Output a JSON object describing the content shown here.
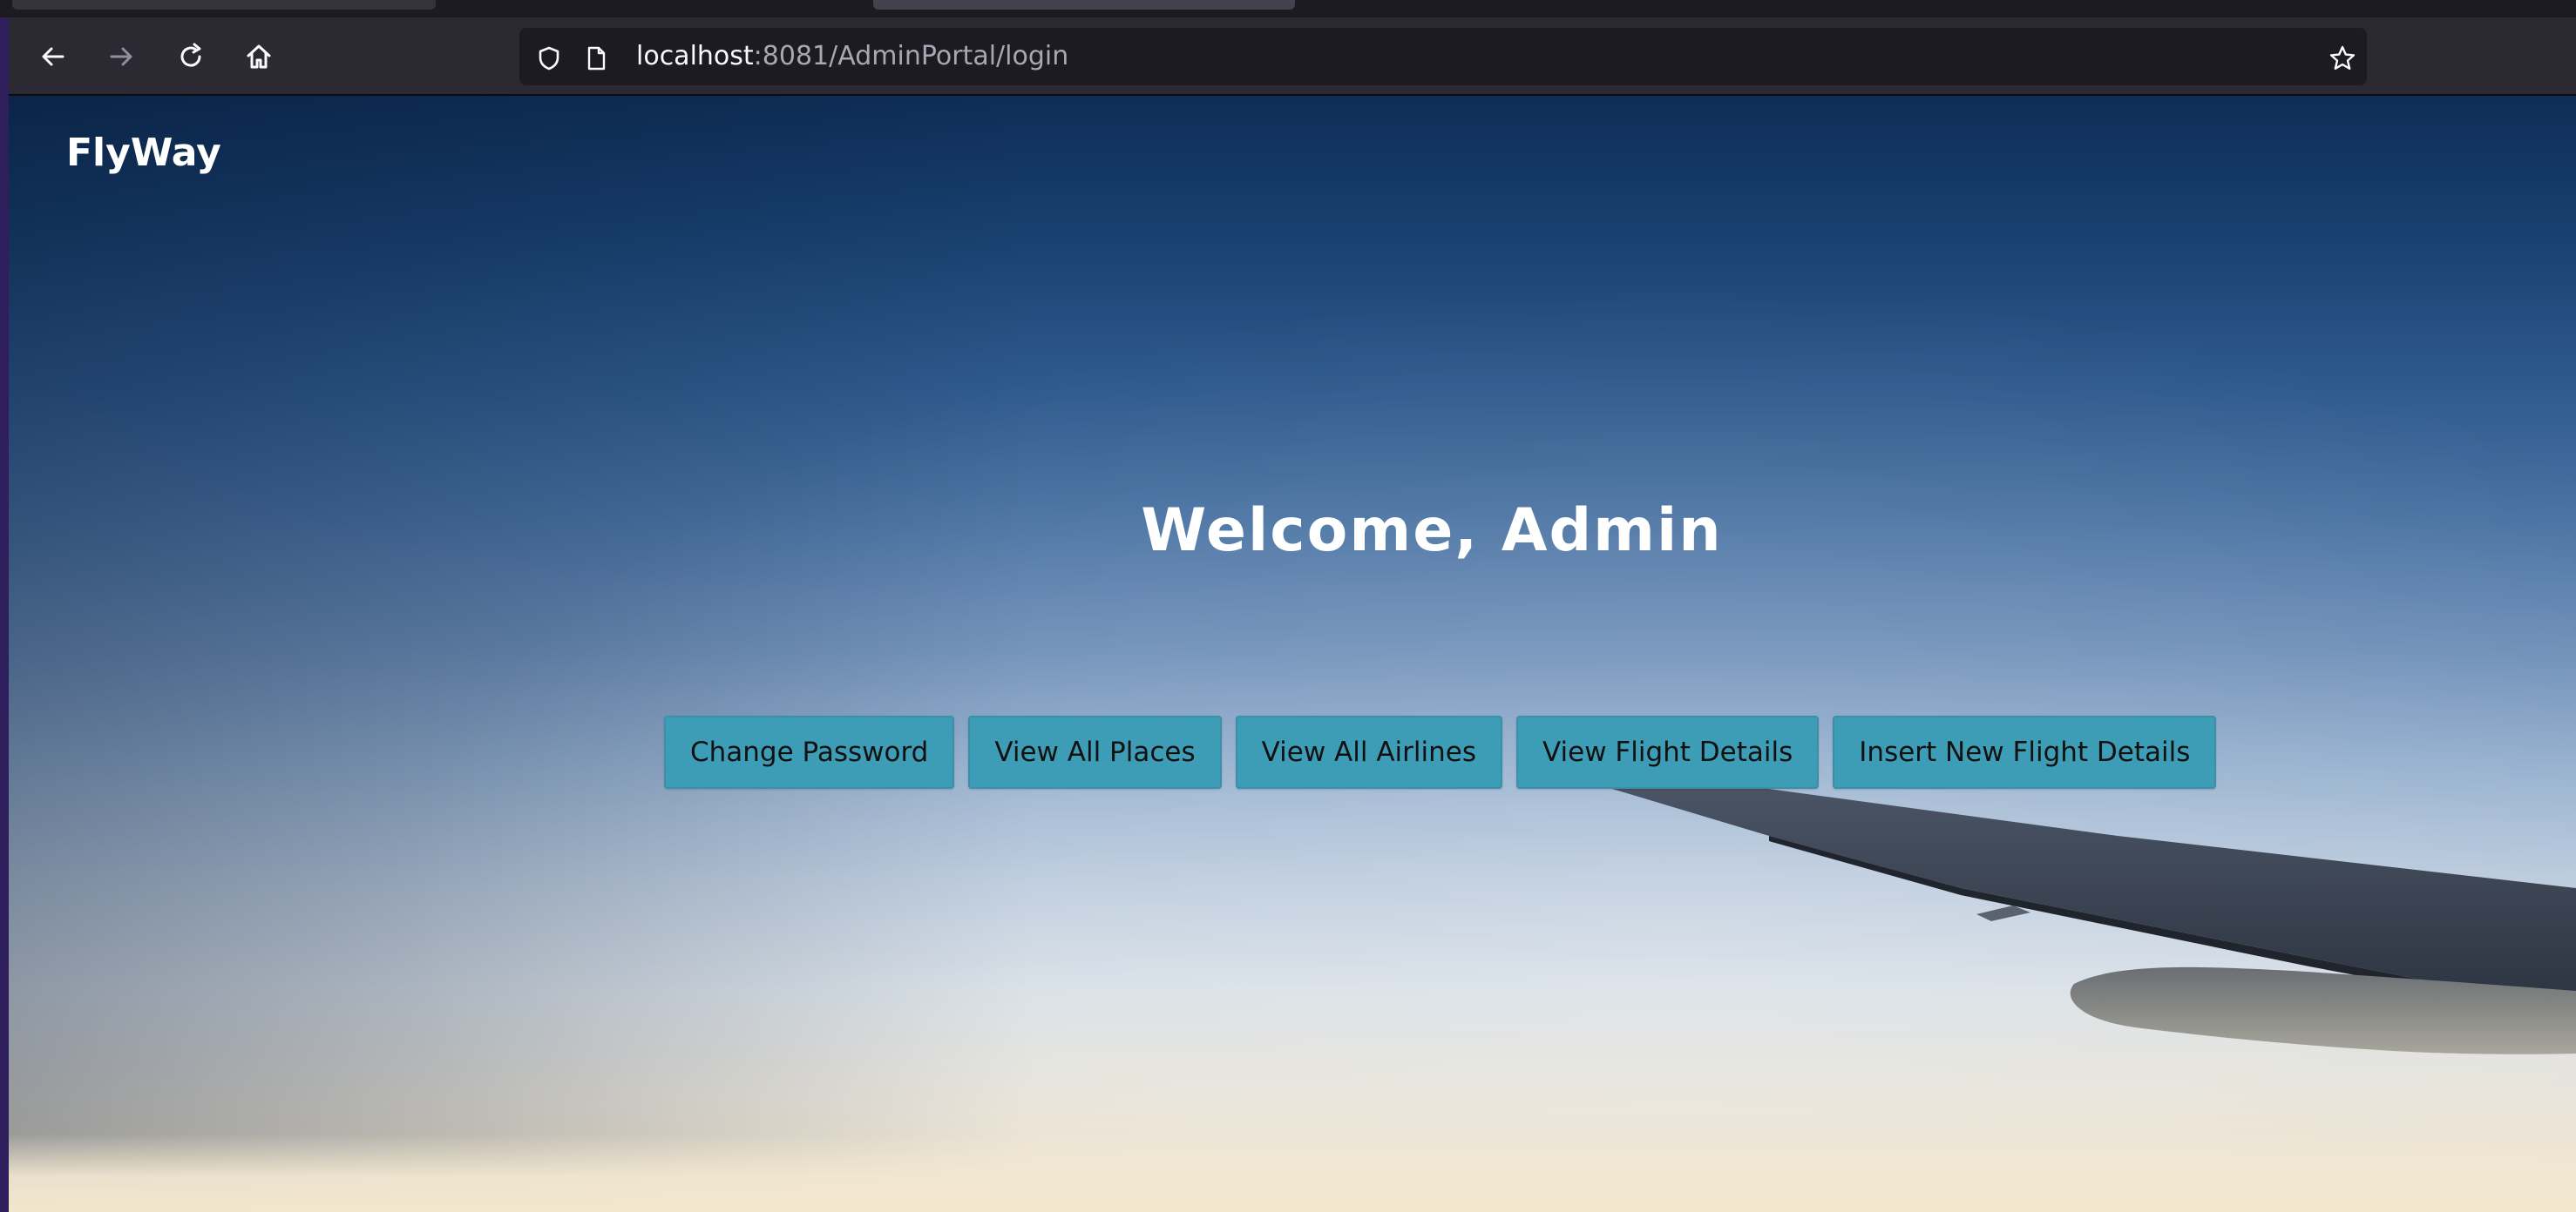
{
  "browser": {
    "url_host": "localhost",
    "url_rest": ":8081/AdminPortal/login",
    "nav_icons": [
      "back-arrow-icon",
      "forward-arrow-icon",
      "reload-icon",
      "home-icon"
    ],
    "url_icons": [
      "shield-icon",
      "page-icon",
      "star-bookmark-icon"
    ]
  },
  "page": {
    "brand": "FlyWay",
    "welcome": "Welcome, Admin",
    "buttons": [
      "Change Password",
      "View All Places",
      "View All Airlines",
      "View Flight Details",
      "Insert New Flight Details"
    ],
    "button_color": "#3e9db6"
  }
}
